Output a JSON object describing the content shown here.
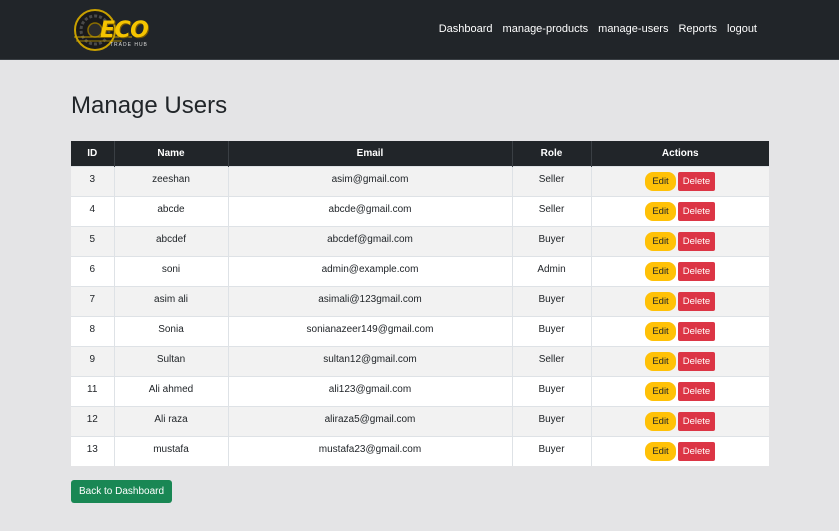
{
  "brand": {
    "name": "ECO",
    "tagline": "TRADE HUB"
  },
  "nav": {
    "links": [
      "Dashboard",
      "manage-products",
      "manage-users",
      "Reports",
      "logout"
    ]
  },
  "page": {
    "title": "Manage Users"
  },
  "table": {
    "headers": [
      "ID",
      "Name",
      "Email",
      "Role",
      "Actions"
    ],
    "rows": [
      {
        "id": "3",
        "name": "zeeshan",
        "email": "asim@gmail.com",
        "role": "Seller"
      },
      {
        "id": "4",
        "name": "abcde",
        "email": "abcde@gmail.com",
        "role": "Seller"
      },
      {
        "id": "5",
        "name": "abcdef",
        "email": "abcdef@gmail.com",
        "role": "Buyer"
      },
      {
        "id": "6",
        "name": "soni",
        "email": "admin@example.com",
        "role": "Admin"
      },
      {
        "id": "7",
        "name": "asim ali",
        "email": "asimali@123gmail.com",
        "role": "Buyer"
      },
      {
        "id": "8",
        "name": "Sonia",
        "email": "sonianazeer149@gmail.com",
        "role": "Buyer"
      },
      {
        "id": "9",
        "name": "Sultan",
        "email": "sultan12@gmail.com",
        "role": "Seller"
      },
      {
        "id": "11",
        "name": "Ali ahmed",
        "email": "ali123@gmail.com",
        "role": "Buyer"
      },
      {
        "id": "12",
        "name": "Ali raza",
        "email": "aliraza5@gmail.com",
        "role": "Buyer"
      },
      {
        "id": "13",
        "name": "mustafa",
        "email": "mustafa23@gmail.com",
        "role": "Buyer"
      }
    ],
    "edit_label": "Edit",
    "delete_label": "Delete"
  },
  "back_button": {
    "label": "Back to Dashboard"
  },
  "colors": {
    "navbar": "#212529",
    "page_bg": "#e4e4e6",
    "edit": "#ffc107",
    "delete": "#dc3545",
    "back": "#198754",
    "brand": "#f5c400"
  },
  "icons": {
    "logo": "tire-wheel-icon"
  }
}
